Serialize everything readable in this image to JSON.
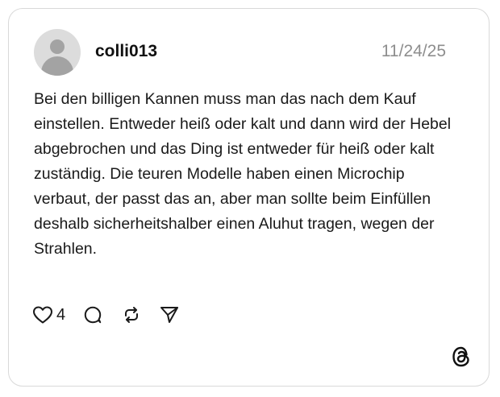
{
  "post": {
    "username": "colli013",
    "date": "11/24/25",
    "text": "Bei den billigen Kannen muss man das nach dem Kauf einstellen. Entweder heiß oder kalt und dann wird der Hebel abgebrochen und das Ding ist entweder für heiß oder kalt zuständig. Die teuren Modelle haben einen Microchip verbaut, der passt das an, aber man sollte beim Einfüllen deshalb sicherheitshalber einen Aluhut tragen, wegen der Strahlen."
  },
  "actions": {
    "like_count": "4",
    "icons": [
      "heart-icon",
      "comment-icon",
      "repost-icon",
      "share-icon"
    ]
  },
  "branding": {
    "logo": "threads-logo-icon"
  },
  "colors": {
    "text": "#1a1a1a",
    "muted": "#8e8e8e",
    "border": "#d9d9d9",
    "avatar_bg": "#dcdcdc",
    "avatar_fg": "#a3a3a3"
  }
}
